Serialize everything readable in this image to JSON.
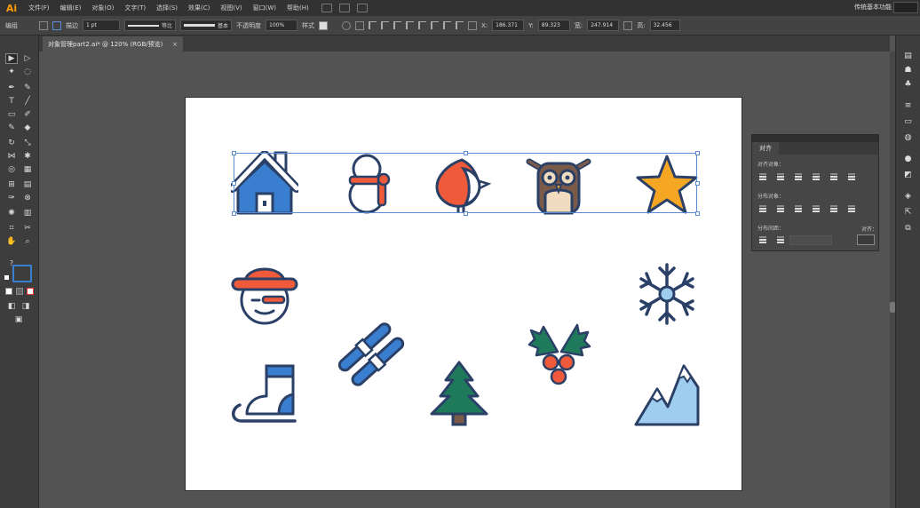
{
  "app": {
    "logo": "Ai",
    "workspace": "传统基本功能"
  },
  "menu": [
    "文件(F)",
    "编辑(E)",
    "对象(O)",
    "文字(T)",
    "选择(S)",
    "效果(C)",
    "视图(V)",
    "窗口(W)",
    "帮助(H)"
  ],
  "control": {
    "object_type": "编组",
    "stroke_label": "描边",
    "stroke_weight": "1 pt",
    "profile": "等比",
    "brush": "基本",
    "opacity_label": "不透明度",
    "opacity": "100%",
    "style_label": "样式",
    "x": "186.371",
    "y": "89.323",
    "w": "247.914",
    "h": "32.456"
  },
  "document": {
    "tab_title": "对象管理part2.ai* @ 120% (RGB/预览)",
    "close": "×"
  },
  "align_panel": {
    "tab": "对齐",
    "align_objects": "对齐对象：",
    "distribute_objects": "分布对象：",
    "distribute_spacing": "分布间距：",
    "align_to": "对齐："
  },
  "colors": {
    "navy": "#2b4066",
    "blue": "#3a7fcf",
    "orange_red": "#ef5a3a",
    "star": "#f5a623",
    "green": "#1f7a5c",
    "light_blue": "#9ecdf0",
    "beige": "#f2dcc0",
    "brown": "#7a5a48"
  },
  "icons": [
    "house-icon",
    "snowman-icon",
    "bird-icon",
    "owl-icon",
    "star-icon",
    "snowman-head-icon",
    "snowflake-icon",
    "ski-icon",
    "holly-icon",
    "tree-icon",
    "skate-icon",
    "mountain-icon"
  ]
}
